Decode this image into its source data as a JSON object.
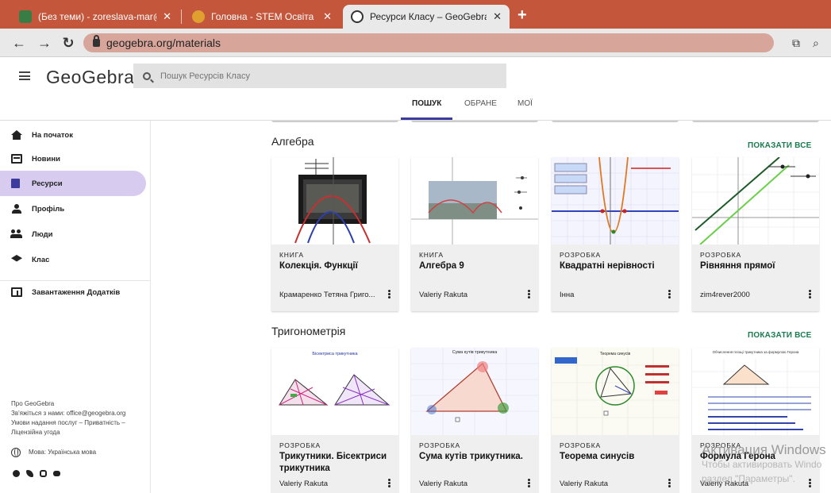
{
  "browser": {
    "tabs": [
      {
        "title": "(Без теми) - zoreslava-mar@ukr",
        "favicon_color": "#3a7d44"
      },
      {
        "title": "Головна - STEM Освіта",
        "favicon_color": "#e0a030"
      },
      {
        "title": "Ресурси Класу – GeoGebra",
        "favicon_color": "#333333"
      }
    ],
    "url": "geogebra.org/materials",
    "accent": "#c4563c"
  },
  "header": {
    "logo": "GeoGebra",
    "search_placeholder": "Пошук Ресурсів Класу",
    "tabs": [
      "ПОШУК",
      "ОБРАНЕ",
      "МОЇ"
    ]
  },
  "sidebar": {
    "items": [
      {
        "label": "На початок",
        "icon": "home-icon"
      },
      {
        "label": "Новини",
        "icon": "news-icon"
      },
      {
        "label": "Ресурси",
        "icon": "resources-icon"
      },
      {
        "label": "Профіль",
        "icon": "profile-icon"
      },
      {
        "label": "Люди",
        "icon": "people-icon"
      },
      {
        "label": "Клас",
        "icon": "class-icon"
      }
    ],
    "download_label": "Завантаження Додатків",
    "footer": {
      "about": "Про GeoGebra",
      "contact": "Зв'яжіться з нами: office@geogebra.org",
      "terms": "Умови надання послуг – Приватність –",
      "license": "Ліцензійна угода",
      "language": "Мова: Українська мова"
    }
  },
  "sections": [
    {
      "title": "Алгебра",
      "show_all": "ПОКАЗАТИ ВСЕ",
      "cards": [
        {
          "type": "КНИГА",
          "title": "Колекція. Функції",
          "author": "Крамаренко Тетяна Григо..."
        },
        {
          "type": "КНИГА",
          "title": "Алгебра 9",
          "author": "Valeriy Rakuta"
        },
        {
          "type": "РОЗРОБКА",
          "title": "Квадратні нерівності",
          "author": "Інна"
        },
        {
          "type": "РОЗРОБКА",
          "title": "Рівняння прямої",
          "author": "zim4rever2000"
        }
      ]
    },
    {
      "title": "Тригонометрія",
      "show_all": "ПОКАЗАТИ ВСЕ",
      "cards": [
        {
          "type": "РОЗРОБКА",
          "title": "Трикутники. Бісектриси трикутника",
          "author": "Valeriy Rakuta"
        },
        {
          "type": "РОЗРОБКА",
          "title": "Сума кутів трикутника.",
          "author": "Valeriy Rakuta"
        },
        {
          "type": "РОЗРОБКА",
          "title": "Теорема синусів",
          "author": "Valeriy Rakuta"
        },
        {
          "type": "РОЗРОБКА",
          "title": "Формула Герона",
          "author": "Valeriy Rakuta"
        }
      ]
    }
  ],
  "thumbnails": {
    "bisectors_title": "Бісектриса трикутника",
    "angles_title": "Сума кутів трикутника",
    "sines_title": "Теорема синусів",
    "heron_title": "Обчислення площі трикутника за формулою Герона"
  },
  "watermark": {
    "line1": "Активация Windows",
    "line2": "Чтобы активировать Windo",
    "line3": "раздел \"Параметры\"."
  }
}
